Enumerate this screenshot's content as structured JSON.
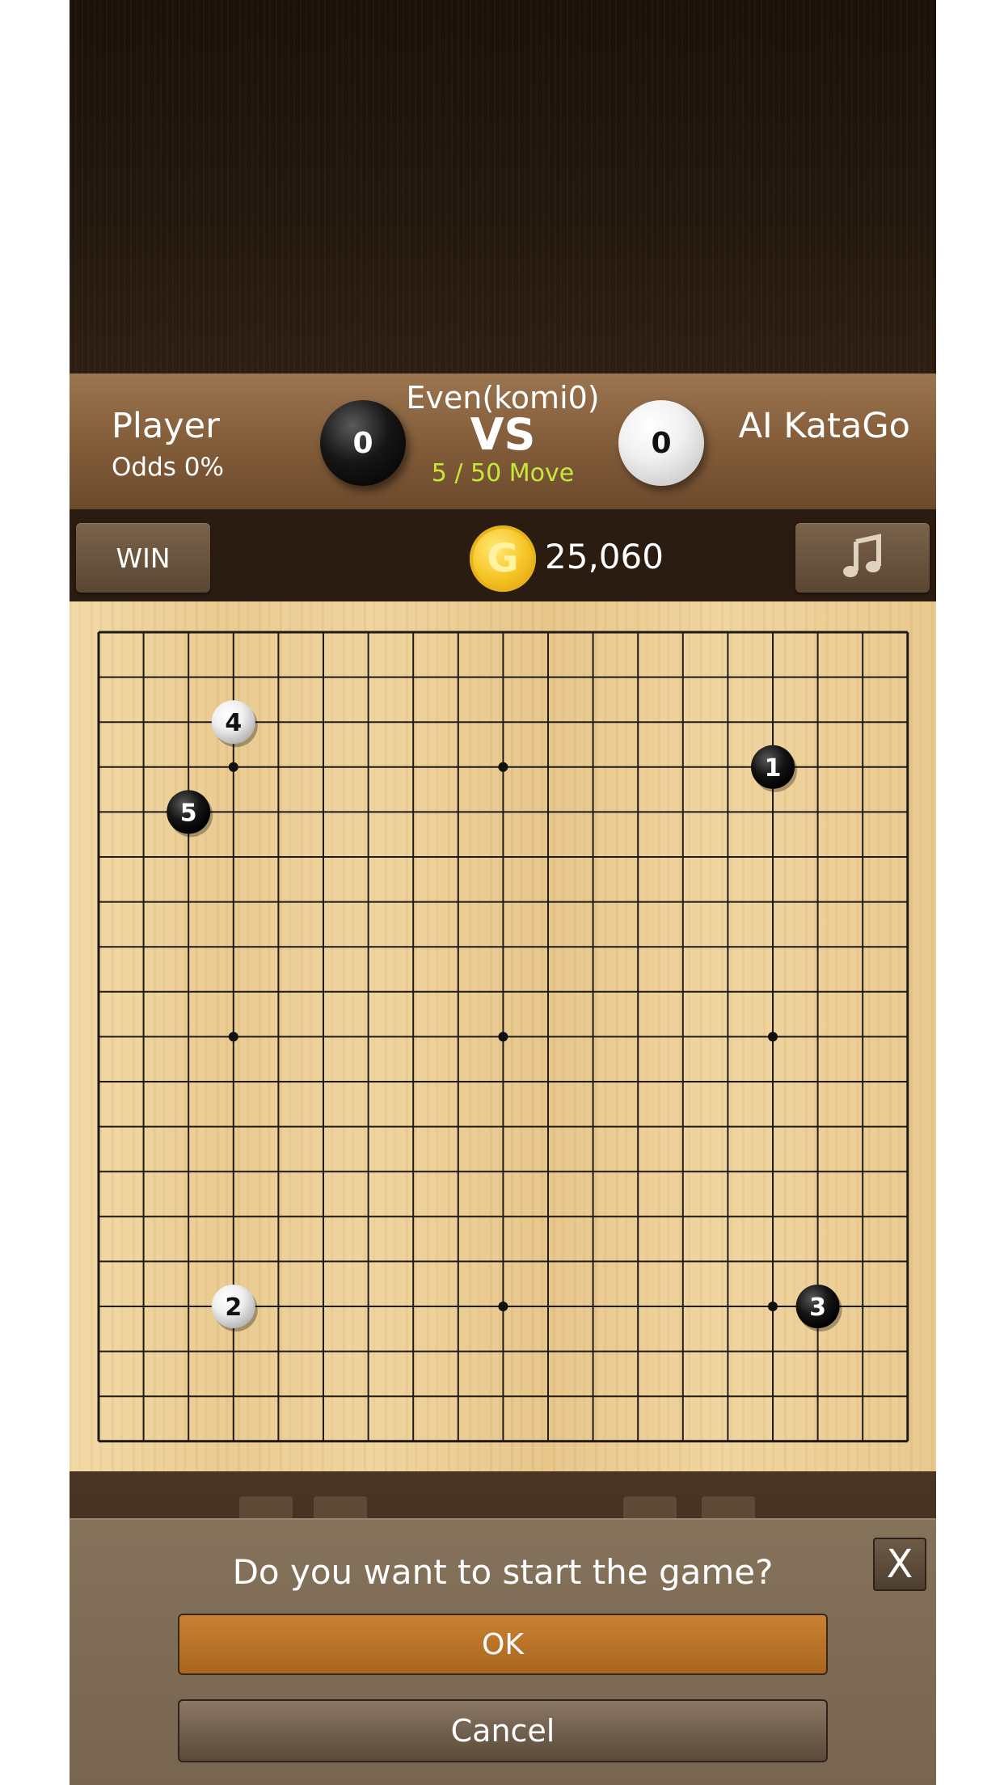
{
  "header": {
    "player_name": "Player",
    "player_odds": "Odds 0%",
    "opponent_name": "AI KataGo",
    "mode": "Even(komi0)",
    "vs": "VS",
    "move_count": "5 / 50 Move",
    "black_captures": "0",
    "white_captures": "0"
  },
  "toolbar": {
    "win_label": "WIN",
    "coin_symbol": "G",
    "coins": "25,060",
    "music_icon": "music-note-icon"
  },
  "board": {
    "size": 19,
    "star_points": [
      [
        4,
        4
      ],
      [
        10,
        4
      ],
      [
        16,
        4
      ],
      [
        4,
        10
      ],
      [
        10,
        10
      ],
      [
        16,
        10
      ],
      [
        4,
        16
      ],
      [
        10,
        16
      ],
      [
        16,
        16
      ]
    ],
    "stones": [
      {
        "move": "1",
        "color": "black",
        "col": 16,
        "row": 4
      },
      {
        "move": "2",
        "color": "white",
        "col": 4,
        "row": 16
      },
      {
        "move": "3",
        "color": "black",
        "col": 17,
        "row": 16
      },
      {
        "move": "4",
        "color": "white",
        "col": 4,
        "row": 3
      },
      {
        "move": "5",
        "color": "black",
        "col": 3,
        "row": 5
      }
    ]
  },
  "dialog": {
    "title": "Do you want to start the game?",
    "close_label": "X",
    "ok_label": "OK",
    "cancel_label": "Cancel"
  },
  "colors": {
    "move_count": "#c6e83c",
    "ok_button": "#b8722a",
    "board_wood": "#ecd096"
  }
}
